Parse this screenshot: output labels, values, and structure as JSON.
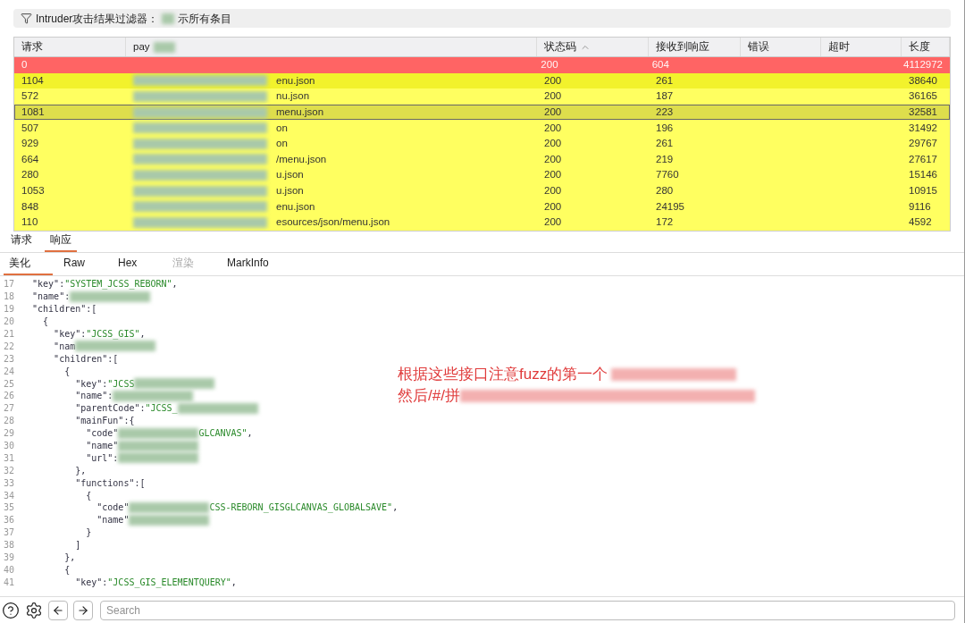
{
  "filter_bar": {
    "label": "Intruder攻击结果过滤器：",
    "value": "示所有条目"
  },
  "table": {
    "columns": [
      {
        "label": "请求",
        "sorted": false
      },
      {
        "label": "pay",
        "sorted": false
      },
      {
        "label": "状态码",
        "sorted": true
      },
      {
        "label": "接收到响应",
        "sorted": false
      },
      {
        "label": "错误",
        "sorted": false
      },
      {
        "label": "超时",
        "sorted": false
      },
      {
        "label": "长度",
        "sorted": false
      }
    ],
    "rows": [
      {
        "request": "0",
        "status": "200",
        "received": "604",
        "length": "4112972",
        "color": "#ff6464",
        "selected": false
      },
      {
        "request": "1104",
        "payload": "enu.json",
        "status": "200",
        "received": "261",
        "length": "38640",
        "color": "#f2f22c",
        "selected": false
      },
      {
        "request": "572",
        "payload": "nu.json",
        "status": "200",
        "received": "187",
        "length": "36165",
        "color": "#ffff60",
        "selected": false
      },
      {
        "request": "1081",
        "payload": "menu.json",
        "status": "200",
        "received": "223",
        "length": "32581",
        "color": "#dede4c",
        "selected": true
      },
      {
        "request": "507",
        "payload": "on",
        "status": "200",
        "received": "196",
        "length": "31492",
        "color": "#ffff60",
        "selected": false
      },
      {
        "request": "929",
        "payload": "on",
        "status": "200",
        "received": "261",
        "length": "29767",
        "color": "#ffff60",
        "selected": false
      },
      {
        "request": "664",
        "payload": "/menu.json",
        "status": "200",
        "received": "219",
        "length": "27617",
        "color": "#ffff60",
        "selected": false
      },
      {
        "request": "280",
        "payload": "u.json",
        "status": "200",
        "received": "7760",
        "length": "15146",
        "color": "#ffff60",
        "selected": false
      },
      {
        "request": "1053",
        "payload": "u.json",
        "status": "200",
        "received": "280",
        "length": "10915",
        "color": "#ffff60",
        "selected": false
      },
      {
        "request": "848",
        "payload": "enu.json",
        "status": "200",
        "received": "24195",
        "length": "9116",
        "color": "#ffff60",
        "selected": false
      },
      {
        "request": "110",
        "payload": "esources/json/menu.json",
        "status": "200",
        "received": "172",
        "length": "4592",
        "color": "#ffff60",
        "selected": false
      }
    ]
  },
  "tabs": [
    {
      "label": "请求",
      "selected": false
    },
    {
      "label": "响应",
      "selected": true
    }
  ],
  "view_tabs": [
    {
      "label": "美化",
      "selected": true
    },
    {
      "label": "Raw",
      "selected": false
    },
    {
      "label": "Hex",
      "selected": false
    },
    {
      "label": "渲染",
      "selected": false
    },
    {
      "label": "MarkInfo",
      "selected": false
    }
  ],
  "code": [
    {
      "n": "17",
      "parts": [
        {
          "kind": "plain",
          "text": "  \"key\":"
        },
        {
          "kind": "string",
          "text": "\"SYSTEM_JCSS_REBORN\""
        },
        {
          "kind": "plain",
          "text": ","
        }
      ]
    },
    {
      "n": "18",
      "parts": [
        {
          "kind": "plain",
          "text": "  \"name\":"
        },
        {
          "kind": "redacted"
        }
      ]
    },
    {
      "n": "19",
      "parts": [
        {
          "kind": "plain",
          "text": "  \"children\":["
        }
      ]
    },
    {
      "n": "20",
      "parts": [
        {
          "kind": "plain",
          "text": "    {"
        }
      ]
    },
    {
      "n": "21",
      "parts": [
        {
          "kind": "plain",
          "text": "      \"key\":"
        },
        {
          "kind": "string",
          "text": "\"JCSS_GIS\""
        },
        {
          "kind": "plain",
          "text": ","
        }
      ]
    },
    {
      "n": "22",
      "parts": [
        {
          "kind": "plain",
          "text": "      \"nam"
        },
        {
          "kind": "redacted"
        }
      ]
    },
    {
      "n": "23",
      "parts": [
        {
          "kind": "plain",
          "text": "      \"children\":["
        }
      ]
    },
    {
      "n": "24",
      "parts": [
        {
          "kind": "plain",
          "text": "        {"
        }
      ]
    },
    {
      "n": "25",
      "parts": [
        {
          "kind": "plain",
          "text": "          \"key\":"
        },
        {
          "kind": "string",
          "text": "\"JCSS"
        },
        {
          "kind": "redacted"
        }
      ]
    },
    {
      "n": "26",
      "parts": [
        {
          "kind": "plain",
          "text": "          \"name\":"
        },
        {
          "kind": "redacted"
        }
      ]
    },
    {
      "n": "27",
      "parts": [
        {
          "kind": "plain",
          "text": "          \"parentCode\":"
        },
        {
          "kind": "string",
          "text": "\"JCSS_"
        },
        {
          "kind": "redacted"
        }
      ]
    },
    {
      "n": "28",
      "parts": [
        {
          "kind": "plain",
          "text": "          \"mainFun\":{"
        }
      ]
    },
    {
      "n": "29",
      "parts": [
        {
          "kind": "plain",
          "text": "            \"code\""
        },
        {
          "kind": "redacted"
        },
        {
          "kind": "string",
          "text": "GLCANVAS\""
        },
        {
          "kind": "plain",
          "text": ","
        }
      ]
    },
    {
      "n": "30",
      "parts": [
        {
          "kind": "plain",
          "text": "            \"name\""
        },
        {
          "kind": "redacted"
        }
      ]
    },
    {
      "n": "31",
      "parts": [
        {
          "kind": "plain",
          "text": "            \"url\":"
        },
        {
          "kind": "redacted"
        }
      ]
    },
    {
      "n": "32",
      "parts": [
        {
          "kind": "plain",
          "text": "          },"
        }
      ]
    },
    {
      "n": "33",
      "parts": [
        {
          "kind": "plain",
          "text": "          \"functions\":["
        }
      ]
    },
    {
      "n": "34",
      "parts": [
        {
          "kind": "plain",
          "text": "            {"
        }
      ]
    },
    {
      "n": "35",
      "parts": [
        {
          "kind": "plain",
          "text": "              \"code\""
        },
        {
          "kind": "redacted"
        },
        {
          "kind": "string",
          "text": "CSS-REBORN_GISGLCANVAS_GLOBALSAVE\""
        },
        {
          "kind": "plain",
          "text": ","
        }
      ]
    },
    {
      "n": "36",
      "parts": [
        {
          "kind": "plain",
          "text": "              \"name\""
        },
        {
          "kind": "redacted"
        }
      ]
    },
    {
      "n": "37",
      "parts": [
        {
          "kind": "plain",
          "text": "            }"
        }
      ]
    },
    {
      "n": "38",
      "parts": [
        {
          "kind": "plain",
          "text": "          ]"
        }
      ]
    },
    {
      "n": "39",
      "parts": [
        {
          "kind": "plain",
          "text": "        },"
        }
      ]
    },
    {
      "n": "40",
      "parts": [
        {
          "kind": "plain",
          "text": "        {"
        }
      ]
    },
    {
      "n": "41",
      "parts": [
        {
          "kind": "plain",
          "text": "          \"key\":"
        },
        {
          "kind": "string",
          "text": "\"JCSS_GIS_ELEMENTQUERY\""
        },
        {
          "kind": "plain",
          "text": ","
        }
      ]
    }
  ],
  "annotation": [
    "根据这些接口注意fuzz的第一个",
    "然后/#/拼"
  ],
  "search": {
    "placeholder": "Search"
  }
}
